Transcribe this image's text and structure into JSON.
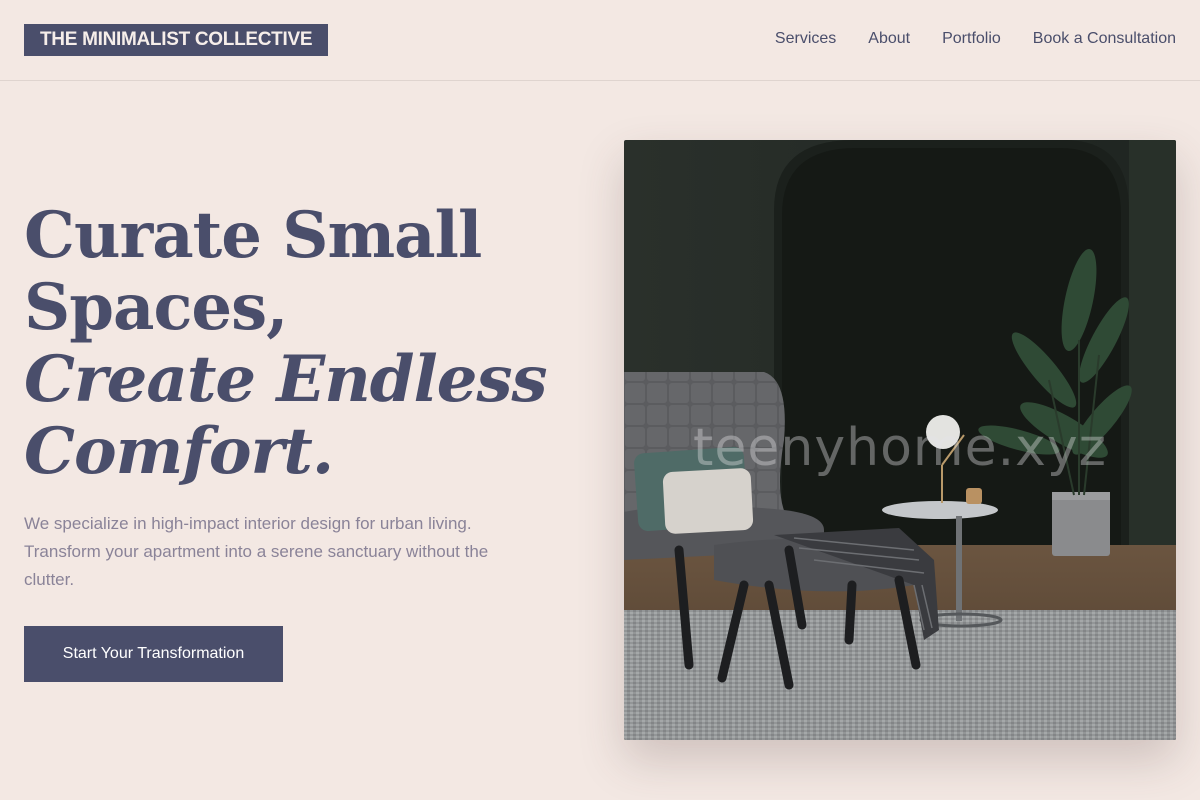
{
  "brand": {
    "name": "THE MINIMALIST COLLECTIVE"
  },
  "nav": {
    "items": [
      "Services",
      "About",
      "Portfolio",
      "Book a Consultation"
    ]
  },
  "hero": {
    "line1": "Curate Small",
    "line2": "Spaces,",
    "line3": "Create Endless",
    "line4": "Comfort.",
    "description": "We specialize in high-impact interior design for urban living. Transform your apartment into a serene sanctuary without the clutter.",
    "cta_label": "Start Your Transformation",
    "watermark": "teenyhome.xyz"
  },
  "colors": {
    "background": "#f3e8e3",
    "primary": "#4a4e6b",
    "muted_text": "#8a8398"
  }
}
